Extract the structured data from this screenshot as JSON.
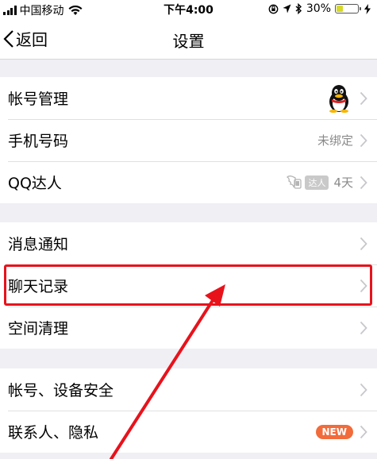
{
  "status_bar": {
    "carrier": "中国移动",
    "time": "下午4:00",
    "battery_percent": "30%",
    "battery_level": 0.3,
    "icons": [
      "signal-icon",
      "wifi-icon",
      "lock-rotation-icon",
      "location-icon",
      "bluetooth-icon",
      "battery-icon",
      "charging-icon"
    ]
  },
  "nav": {
    "back_label": "返回",
    "title": "设置"
  },
  "groups": [
    {
      "rows": [
        {
          "label": "帐号管理",
          "right_type": "avatar"
        },
        {
          "label": "手机号码",
          "right_text": "未绑定"
        },
        {
          "label": "QQ达人",
          "badge_text": "达人",
          "right_text": "4天"
        }
      ]
    },
    {
      "rows": [
        {
          "label": "消息通知"
        },
        {
          "label": "聊天记录",
          "highlighted": true
        },
        {
          "label": "空间清理"
        }
      ]
    },
    {
      "rows": [
        {
          "label": "帐号、设备安全"
        },
        {
          "label": "联系人、隐私",
          "badge_text": "NEW"
        }
      ]
    }
  ],
  "annotation": {
    "color": "#e8121b"
  }
}
